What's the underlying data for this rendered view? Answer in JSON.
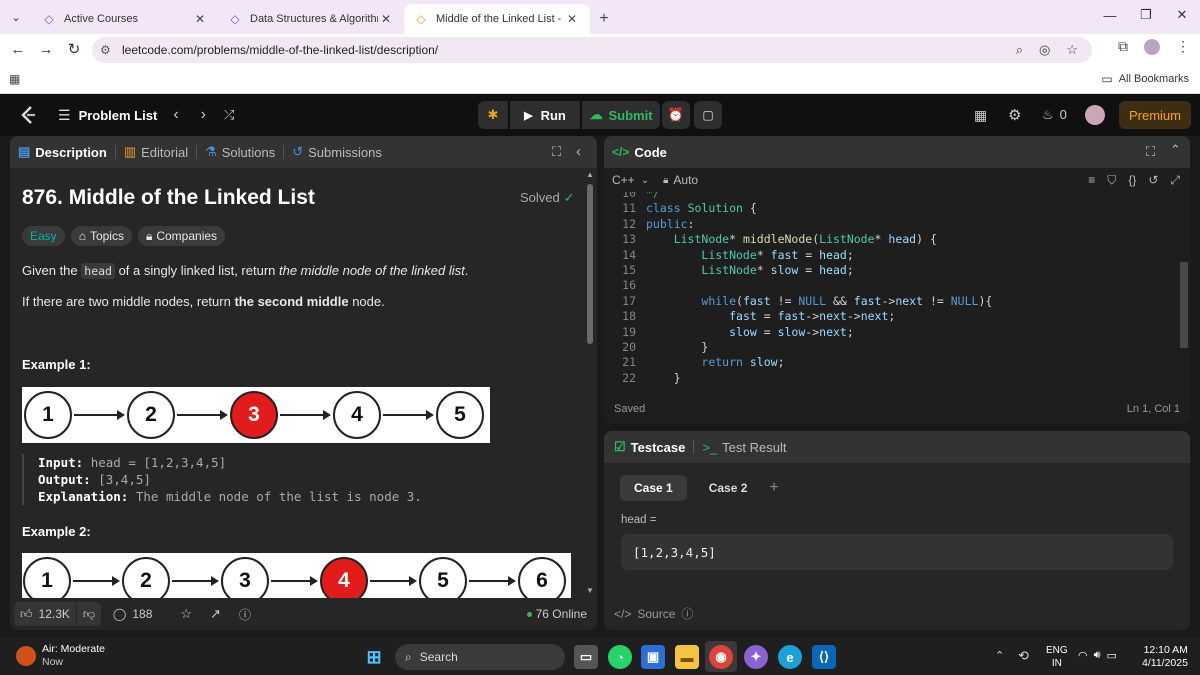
{
  "browser": {
    "tabs": [
      {
        "title": "Active Courses",
        "active": false
      },
      {
        "title": "Data Structures & Algorithms M",
        "active": false
      },
      {
        "title": "Middle of the Linked List - Leet",
        "active": true
      }
    ],
    "url": "leetcode.com/problems/middle-of-the-linked-list/description/",
    "bookmarks_label": "All Bookmarks"
  },
  "nav": {
    "problem_list": "Problem List",
    "run": "Run",
    "submit": "Submit",
    "streak": "0",
    "premium": "Premium"
  },
  "left": {
    "tabs": {
      "description": "Description",
      "editorial": "Editorial",
      "solutions": "Solutions",
      "submissions": "Submissions"
    },
    "title": "876. Middle of the Linked List",
    "status": "Solved",
    "difficulty": "Easy",
    "topics": "Topics",
    "companies": "Companies",
    "p1_pre": "Given the ",
    "p1_code": "head",
    "p1_mid": " of a singly linked list, return ",
    "p1_em": "the middle node of the linked list",
    "p1_end": ".",
    "p2_pre": "If there are two middle nodes, return ",
    "p2_strong": "the second middle",
    "p2_end": " node.",
    "ex1_title": "Example 1:",
    "ex1_nodes": [
      "1",
      "2",
      "3",
      "4",
      "5"
    ],
    "ex1_middle_index": 2,
    "ex1_input_label": "Input:",
    "ex1_input": "head = [1,2,3,4,5]",
    "ex1_output_label": "Output:",
    "ex1_output": "[3,4,5]",
    "ex1_expl_label": "Explanation:",
    "ex1_expl": "The middle node of the list is node 3.",
    "ex2_title": "Example 2:",
    "ex2_nodes": [
      "1",
      "2",
      "3",
      "4",
      "5",
      "6"
    ],
    "ex2_middle_index": 3,
    "likes": "12.3K",
    "comments": "188",
    "online": "76 Online"
  },
  "code": {
    "title": "Code",
    "language": "C++",
    "mode": "Auto",
    "lines": [
      {
        "n": "10",
        "t": "*/"
      },
      {
        "n": "11",
        "t": "class Solution {"
      },
      {
        "n": "12",
        "t": "public:"
      },
      {
        "n": "13",
        "t": "    ListNode* middleNode(ListNode* head) {"
      },
      {
        "n": "14",
        "t": "        ListNode* fast = head;"
      },
      {
        "n": "15",
        "t": "        ListNode* slow = head;"
      },
      {
        "n": "16",
        "t": ""
      },
      {
        "n": "17",
        "t": "        while(fast != NULL && fast->next != NULL){"
      },
      {
        "n": "18",
        "t": "            fast = fast->next->next;"
      },
      {
        "n": "19",
        "t": "            slow = slow->next;"
      },
      {
        "n": "20",
        "t": "        }"
      },
      {
        "n": "21",
        "t": "        return slow;"
      },
      {
        "n": "22",
        "t": "    }"
      }
    ],
    "saved": "Saved",
    "cursor": "Ln 1, Col 1"
  },
  "testcase": {
    "tab": "Testcase",
    "result_tab": "Test Result",
    "cases": [
      "Case 1",
      "Case 2"
    ],
    "var_label": "head =",
    "value": "[1,2,3,4,5]",
    "source": "Source"
  },
  "taskbar": {
    "weather_title": "Air: Moderate",
    "weather_sub": "Now",
    "search": "Search",
    "lang1": "ENG",
    "lang2": "IN",
    "time": "12:10 AM",
    "date": "4/11/2025"
  }
}
